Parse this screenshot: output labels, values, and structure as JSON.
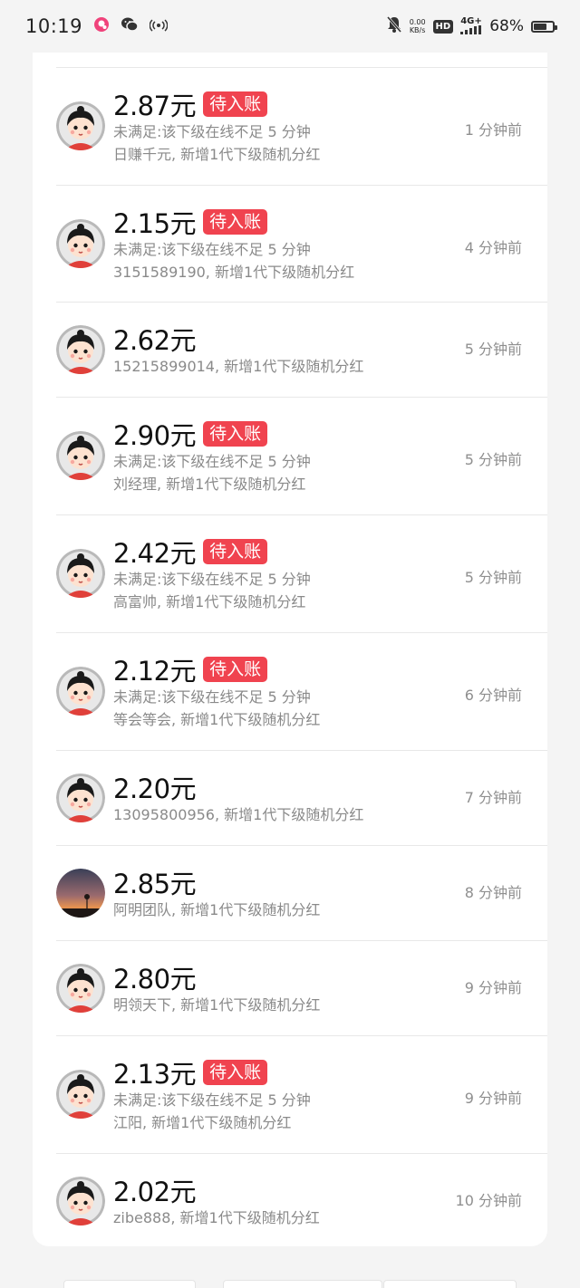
{
  "status_bar": {
    "time": "10:19",
    "net_speed_value": "0.00",
    "net_speed_unit": "KB/s",
    "hd_label": "HD",
    "network_label": "4G+",
    "battery_percent": "68%",
    "battery_level": 0.68,
    "icons": [
      "app-notification-icon",
      "wechat-icon",
      "hotspot-icon",
      "mute-bell-icon",
      "signal-icon",
      "battery-icon"
    ]
  },
  "list": {
    "pending_badge_label": "待入账",
    "items": [
      {
        "amount": "2.87元",
        "pending": true,
        "condition": "未满足:该下级在线不足 5 分钟",
        "detail": "日赚千元, 新增1代下级随机分红",
        "time": "1 分钟前",
        "avatar": "cartoon"
      },
      {
        "amount": "2.15元",
        "pending": true,
        "condition": "未满足:该下级在线不足 5 分钟",
        "detail": "3151589190, 新增1代下级随机分红",
        "time": "4 分钟前",
        "avatar": "cartoon"
      },
      {
        "amount": "2.62元",
        "pending": false,
        "condition": "",
        "detail": "15215899014, 新增1代下级随机分红",
        "time": "5 分钟前",
        "avatar": "cartoon"
      },
      {
        "amount": "2.90元",
        "pending": true,
        "condition": "未满足:该下级在线不足 5 分钟",
        "detail": "刘经理, 新增1代下级随机分红",
        "time": "5 分钟前",
        "avatar": "cartoon"
      },
      {
        "amount": "2.42元",
        "pending": true,
        "condition": "未满足:该下级在线不足 5 分钟",
        "detail": "高富帅, 新增1代下级随机分红",
        "time": "5 分钟前",
        "avatar": "cartoon"
      },
      {
        "amount": "2.12元",
        "pending": true,
        "condition": "未满足:该下级在线不足 5 分钟",
        "detail": "等会等会, 新增1代下级随机分红",
        "time": "6 分钟前",
        "avatar": "cartoon"
      },
      {
        "amount": "2.20元",
        "pending": false,
        "condition": "",
        "detail": "13095800956, 新增1代下级随机分红",
        "time": "7 分钟前",
        "avatar": "cartoon"
      },
      {
        "amount": "2.85元",
        "pending": false,
        "condition": "",
        "detail": "阿明团队, 新增1代下级随机分红",
        "time": "8 分钟前",
        "avatar": "sunset"
      },
      {
        "amount": "2.80元",
        "pending": false,
        "condition": "",
        "detail": "明领天下, 新增1代下级随机分红",
        "time": "9 分钟前",
        "avatar": "cartoon"
      },
      {
        "amount": "2.13元",
        "pending": true,
        "condition": "未满足:该下级在线不足 5 分钟",
        "detail": "江阳, 新增1代下级随机分红",
        "time": "9 分钟前",
        "avatar": "cartoon"
      },
      {
        "amount": "2.02元",
        "pending": false,
        "condition": "",
        "detail": "zibe888, 新增1代下级随机分红",
        "time": "10 分钟前",
        "avatar": "cartoon"
      }
    ]
  },
  "colors": {
    "badge_red": "#f0434f",
    "amount_text": "#111111",
    "secondary_text": "#8a8a8a",
    "background": "#f4f4f4"
  }
}
